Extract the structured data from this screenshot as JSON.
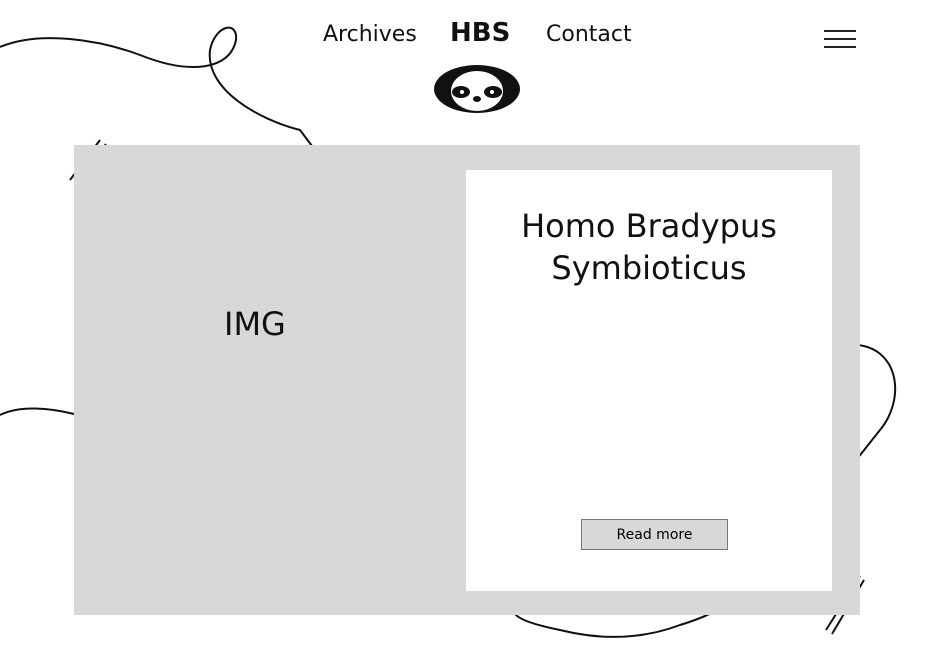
{
  "nav": {
    "archives": "Archives",
    "brand": "HBS",
    "contact": "Contact",
    "menu_icon": "hamburger-icon",
    "logo": "sloth-logo"
  },
  "hero": {
    "image_placeholder": "IMG",
    "title": "Homo Bradypus Symbioticus",
    "read_more": "Read more",
    "background": "#d8d8d8"
  }
}
